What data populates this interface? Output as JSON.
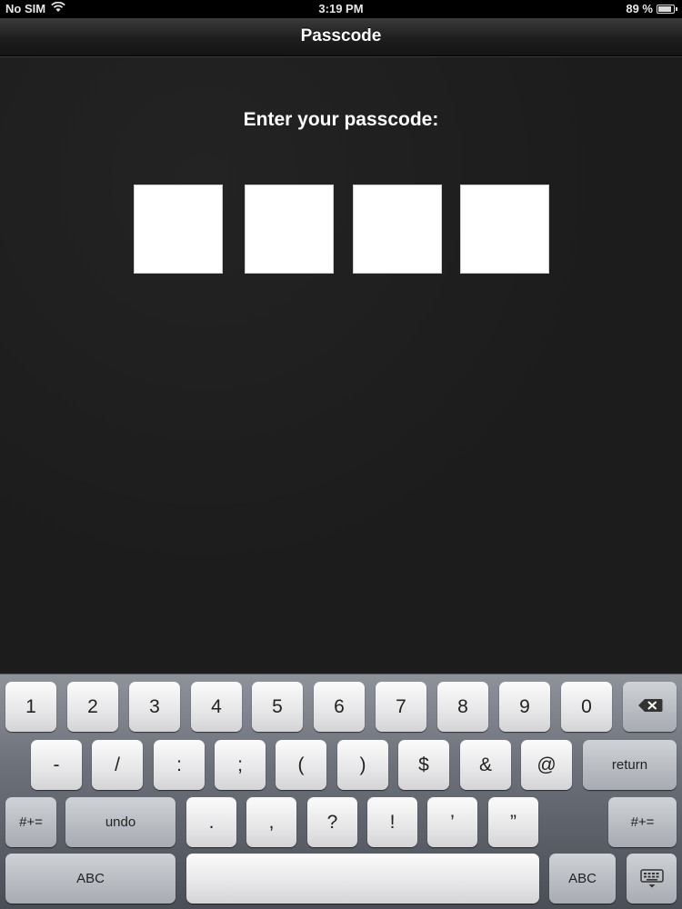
{
  "status_bar": {
    "carrier": "No SIM",
    "wifi_icon": "wifi-icon",
    "time": "3:19 PM",
    "battery_percent": "89 %",
    "battery_level": 0.89
  },
  "nav": {
    "title": "Passcode"
  },
  "main": {
    "prompt": "Enter your passcode:",
    "passcode_digits": [
      "",
      "",
      "",
      ""
    ]
  },
  "keyboard": {
    "row1": [
      "1",
      "2",
      "3",
      "4",
      "5",
      "6",
      "7",
      "8",
      "9",
      "0"
    ],
    "delete_icon": "delete-backspace-icon",
    "row2": [
      "-",
      "/",
      ":",
      ";",
      "(",
      ")",
      "$",
      "&",
      "@"
    ],
    "return_label": "return",
    "row3_left_mode": "#+=",
    "undo_label": "undo",
    "row3": [
      ".",
      ",",
      "?",
      "!",
      "’",
      "”"
    ],
    "row3_right_mode": "#+=",
    "abc_left": "ABC",
    "space_label": "",
    "abc_right": "ABC",
    "hide_keyboard_icon": "keyboard-dismiss-icon"
  }
}
